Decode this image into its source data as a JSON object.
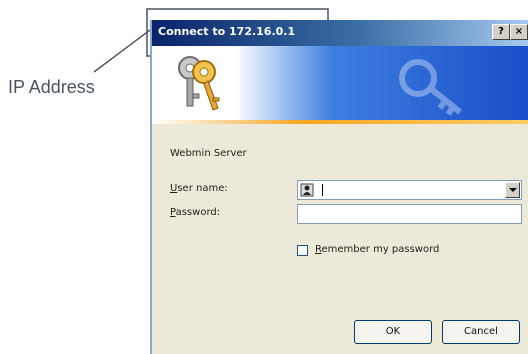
{
  "annotation": {
    "label": "IP Address"
  },
  "dialog": {
    "title": "Connect to 172.16.0.1",
    "help_label": "?",
    "close_label": "×",
    "server_label": "Webmin Server",
    "username": {
      "label_hotkey": "U",
      "label_rest": "ser name:",
      "value": ""
    },
    "password": {
      "label_hotkey": "P",
      "label_rest": "assword:",
      "value": ""
    },
    "remember": {
      "label_hotkey": "R",
      "label_rest": "emember my password",
      "checked": false
    },
    "ok_label": "OK",
    "cancel_label": "Cancel"
  },
  "icons": [
    "keys-icon",
    "user-icon",
    "chevron-down-icon",
    "help-icon",
    "close-icon"
  ],
  "colors": {
    "title_start": "#0a246a",
    "title_end": "#a6caf0",
    "dialog_bg": "#ece9d8",
    "banner_blue": "#1a4ec8",
    "banner_stripe": "#f5a623",
    "annotation_text": "#4a5560"
  }
}
